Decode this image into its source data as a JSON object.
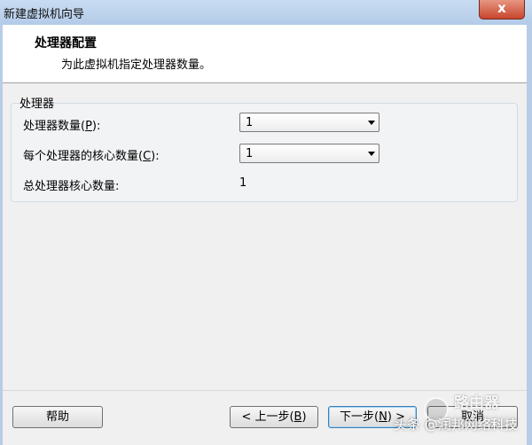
{
  "window": {
    "title": "新建虚拟机向导",
    "close_label": "x"
  },
  "header": {
    "title": "处理器配置",
    "subtitle": "为此虚拟机指定处理器数量。"
  },
  "group": {
    "label": "处理器",
    "rows": [
      {
        "label_before": "处理器数量(",
        "hotkey": "P",
        "label_after": "):",
        "value": "1"
      },
      {
        "label_before": "每个处理器的核心数量(",
        "hotkey": "C",
        "label_after": "):",
        "value": "1"
      },
      {
        "label": "总处理器核心数量:",
        "value": "1"
      }
    ]
  },
  "buttons": {
    "help": "帮助",
    "back_before": "< 上一步(",
    "back_hotkey": "B",
    "back_after": ")",
    "next_before": "下一步(",
    "next_hotkey": "N",
    "next_after": ") >",
    "cancel": "取消"
  },
  "watermark": {
    "text": "头条 @润邦网络科技",
    "brand": "路由器"
  }
}
